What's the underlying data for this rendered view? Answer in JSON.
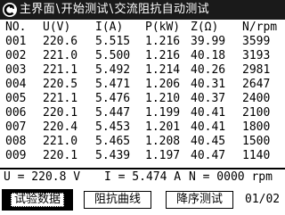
{
  "title": {
    "crumbs": [
      "主界面",
      "开始测试",
      "交流阻抗自动测试"
    ],
    "separator": "\\"
  },
  "table": {
    "headers": [
      "NO.",
      "U(V)",
      "I(A)",
      "P(kW)",
      "Z(Ω)",
      "N/rpm"
    ],
    "rows": [
      [
        "001",
        "220.6",
        "5.515",
        "1.216",
        "39.99",
        "3599"
      ],
      [
        "002",
        "221.0",
        "5.500",
        "1.216",
        "40.18",
        "3193"
      ],
      [
        "003",
        "221.1",
        "5.492",
        "1.214",
        "40.26",
        "2981"
      ],
      [
        "004",
        "220.5",
        "5.471",
        "1.206",
        "40.31",
        "2647"
      ],
      [
        "005",
        "221.1",
        "5.476",
        "1.210",
        "40.37",
        "2400"
      ],
      [
        "006",
        "220.1",
        "5.447",
        "1.199",
        "40.41",
        "2100"
      ],
      [
        "007",
        "220.4",
        "5.453",
        "1.201",
        "40.41",
        "1800"
      ],
      [
        "008",
        "221.0",
        "5.465",
        "1.208",
        "40.45",
        "1500"
      ],
      [
        "009",
        "220.1",
        "5.439",
        "1.197",
        "40.47",
        "1140"
      ]
    ]
  },
  "status": {
    "u": "U = 220.8 V",
    "i": "I = 5.474 A",
    "n": "N = 0000 rpm"
  },
  "buttons": {
    "data": "试验数据",
    "curve": "阻抗曲线",
    "descend": "降序测试"
  },
  "page_indicator": "01/02"
}
